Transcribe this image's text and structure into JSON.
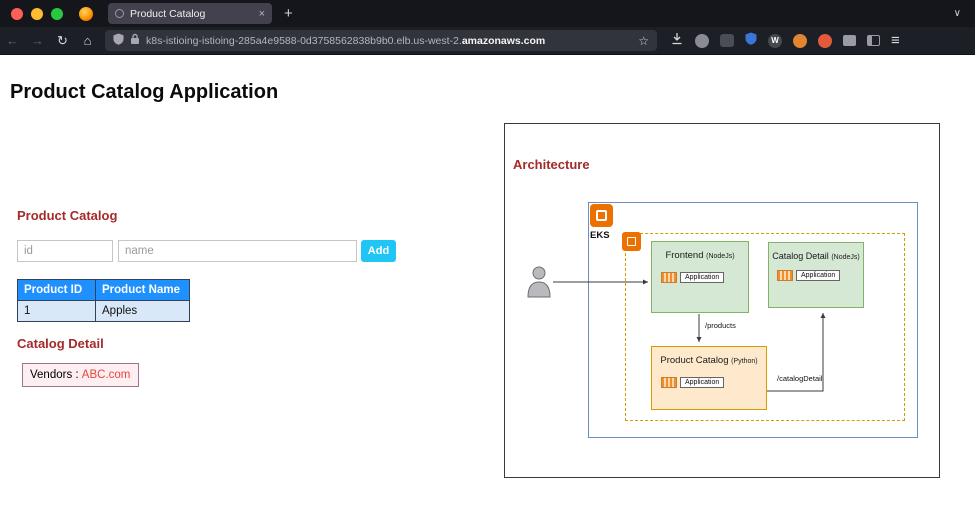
{
  "browser": {
    "tab": {
      "title": "Product Catalog"
    },
    "url": {
      "subdomain": "k8s-istioing-istioing-285a4e9588-0d3758562838b9b0.elb.us-west-2.",
      "domain": "amazonaws.com"
    }
  },
  "icons": {
    "back": "←",
    "forward": "→",
    "reload": "↻",
    "home": "⌂",
    "star": "☆",
    "menu": "≡",
    "new_tab": "+",
    "tab_close": "×",
    "tabs_chevron": "∨",
    "wiki_letter": "W"
  },
  "page": {
    "title": "Product Catalog Application",
    "catalog": {
      "heading": "Product Catalog",
      "id_placeholder": "id",
      "name_placeholder": "name",
      "add_button": "Add",
      "table": {
        "headers": [
          "Product ID",
          "Product Name"
        ],
        "rows": [
          {
            "id": "1",
            "name": "Apples"
          }
        ]
      }
    },
    "detail": {
      "heading": "Catalog Detail",
      "vendors_label": "Vendors :",
      "vendors_value": "ABC.com"
    }
  },
  "architecture": {
    "heading": "Architecture",
    "eks_label": "EKS",
    "nodes": {
      "frontend": {
        "title": "Frontend",
        "runtime": "(NodeJs)",
        "app": "Application"
      },
      "catalog_detail": {
        "title": "Catalog Detail",
        "runtime": "(NodeJs)",
        "app": "Application"
      },
      "product_catalog": {
        "title": "Product Catalog",
        "runtime": "(Python)",
        "app": "Application"
      }
    },
    "edges": {
      "products": "/products",
      "catalog_detail": "/catalogDetail"
    }
  },
  "colors": {
    "heading_maroon": "#a52a2a",
    "add_button_cyan": "#1fc6f5",
    "table_header_blue": "#1e90ff",
    "table_row_blue": "#d9e8f8",
    "vendor_red": "#e8453c",
    "aws_orange": "#ed7100",
    "node_green": "#d5e8d4",
    "node_green_border": "#82b366",
    "node_orange": "#ffe9cc",
    "node_orange_border": "#d79b00",
    "cluster_border_blue": "#6c8ebf"
  }
}
